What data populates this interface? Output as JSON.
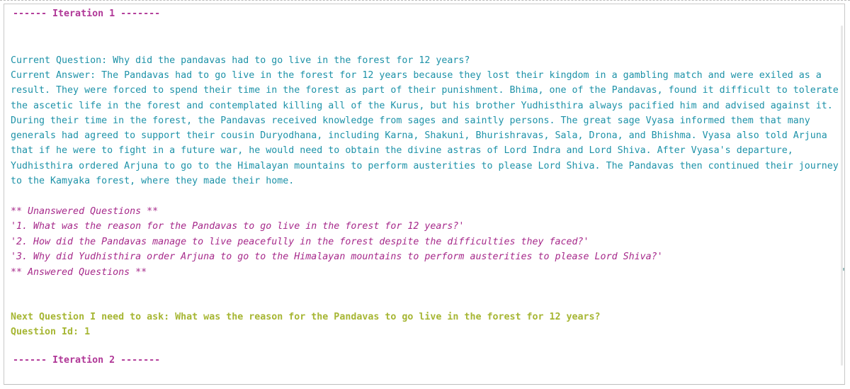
{
  "iterations": {
    "first": " ------  Iteration 1 -------",
    "second": " ------  Iteration 2 -------"
  },
  "current_question": "Current Question: Why did the pandavas had to go live in the forest for 12 years?",
  "current_answer": " Current Answer: The Pandavas had to go live in the forest for 12 years because they lost their kingdom in a gambling match and were exiled as a result. They were forced to spend their time in the forest as part of their punishment. Bhima, one of the Pandavas, found it difficult to tolerate the ascetic life in the forest and contemplated killing all of the Kurus, but his brother Yudhisthira always pacified him and advised against it. During their time in the forest, the Pandavas received knowledge from sages and saintly persons. The great sage Vyasa informed them that many generals had agreed to support their cousin Duryodhana, including Karna, Shakuni, Bhurishravas, Sala, Drona, and Bhishma. Vyasa also told Arjuna that if he were to fight in a future war, he would need to obtain the divine astras of Lord Indra and Lord Shiva. After Vyasa's departure, Yudhisthira ordered Arjuna to go to the Himalayan mountains to perform austerities to please Lord Shiva. The Pandavas then continued their journey to the Kamyaka forest, where they made their home.",
  "unanswered": {
    "heading": " ** Unanswered Questions **",
    "items": [
      " '1. What was the reason for the Pandavas to go live in the forest for 12 years?'",
      "'2. How did the Pandavas manage to live peacefully in the forest despite the difficulties they faced?'",
      "'3. Why did Yudhisthira order Arjuna to go to the Himalayan mountains to perform austerities to please Lord Shiva?'"
    ]
  },
  "answered_heading": "** Answered Questions **",
  "next_question": "Next Question I need to ask:  What was the reason for the Pandavas to go live in the forest for 12 years?",
  "question_id": "Question Id: 1",
  "colors": {
    "teal": "#1d92a8",
    "magenta": "#b03797",
    "olive": "#a6b633"
  }
}
